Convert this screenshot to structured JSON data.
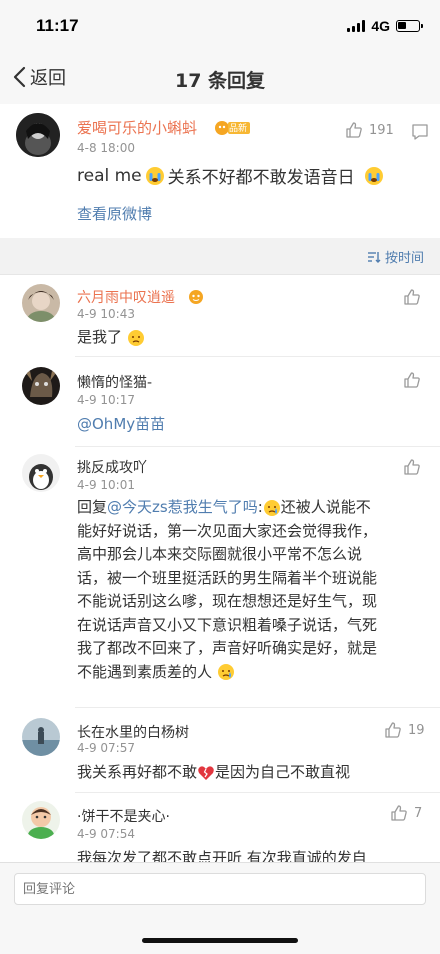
{
  "status_bar": {
    "time": "11:17",
    "network": "4G"
  },
  "nav": {
    "back_label": "返回",
    "title": "17 条回复"
  },
  "original": {
    "author": "爱喝可乐的小蝌蚪",
    "badge": "品新",
    "time": "4-8 18:00",
    "like_count": "191",
    "text_parts": [
      "real me",
      "关系不好都不敢发语音日"
    ],
    "view_original": "查看原微博"
  },
  "sort": {
    "label": "按时间"
  },
  "comments": [
    {
      "author": "六月雨中叹逍遥",
      "time": "4-9 10:43",
      "text": "是我了",
      "likes": "",
      "author_color": "#eb7350"
    },
    {
      "author": "懒惰的怪猫-",
      "time": "4-9 10:17",
      "mention": "@OhMy苗苗",
      "likes": "",
      "author_color": "#333333"
    },
    {
      "author": "挑反成攻吖",
      "time": "4-9 10:01",
      "reply_prefix": "回复",
      "reply_mention": "@今天zs惹我生气了吗",
      "lines": [
        "还被人说能不",
        "能好好说话，第一次见面大家还会觉得我作，",
        "高中那会儿本来交际圈就很小平常不怎么说",
        "话，被一个班里挺活跃的男生隔着半个班说能",
        "不能说话别这么嗲，现在想想还是好生气，现",
        "在说话声音又小又下意识粗着嗓子说话，气死",
        "我了都改不回来了，声音好听确实是好，就是",
        "不能遇到素质差的人"
      ],
      "likes": "",
      "author_color": "#333333"
    },
    {
      "author": "长在水里的白杨树",
      "time": "4-9 07:57",
      "text_a": "我关系再好都不敢",
      "text_b": "是因为自己不敢直视",
      "likes": "19",
      "author_color": "#333333"
    },
    {
      "author": "·饼干不是夹心·",
      "time": "4-9 07:54",
      "text": "我每次发了都不敢点开听 有次我直诚的发自",
      "likes": "7",
      "author_color": "#333333"
    }
  ],
  "input": {
    "placeholder": "回复评论"
  },
  "colors": {
    "accent_orange": "#eb7350",
    "link_blue": "#507daf",
    "meta_gray": "#939393"
  }
}
